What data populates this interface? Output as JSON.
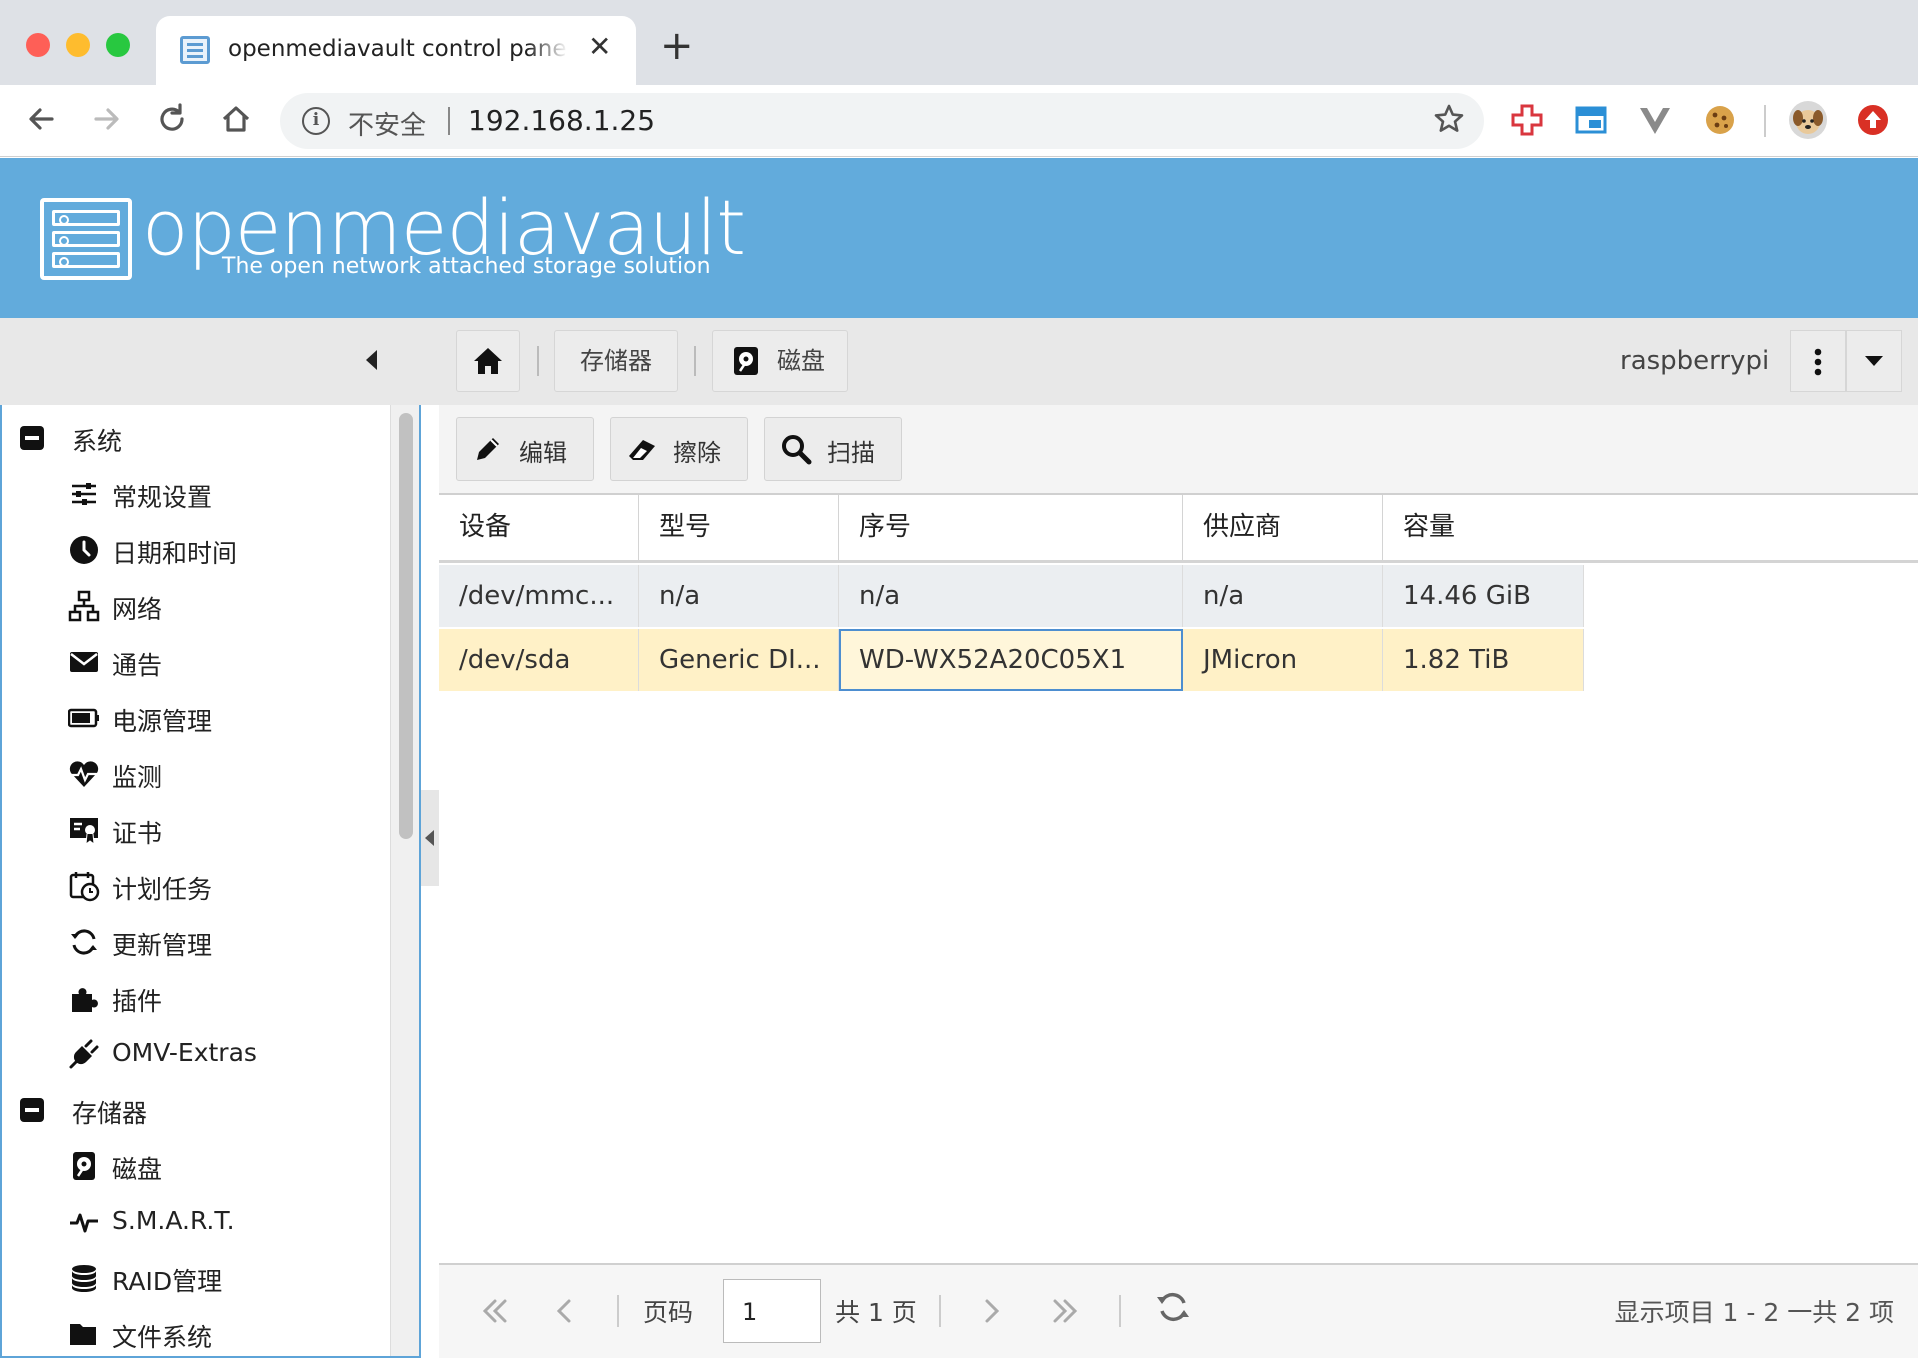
{
  "browser": {
    "tab_title": "openmediavault control panel - raspberrypi",
    "tab_close": "✕",
    "new_tab": "+",
    "security_label": "不安全",
    "url": "192.168.1.25"
  },
  "app": {
    "name": "openmediavault",
    "tagline": "The open network attached storage solution",
    "hostname": "raspberrypi"
  },
  "breadcrumb": [
    {
      "label": "存储器"
    },
    {
      "label": "磁盘"
    }
  ],
  "sidebar": {
    "groups": [
      {
        "label": "系统",
        "items": [
          {
            "label": "常规设置",
            "icon": "sliders-icon"
          },
          {
            "label": "日期和时间",
            "icon": "clock-icon"
          },
          {
            "label": "网络",
            "icon": "network-icon"
          },
          {
            "label": "通告",
            "icon": "envelope-icon"
          },
          {
            "label": "电源管理",
            "icon": "battery-icon"
          },
          {
            "label": "监测",
            "icon": "heartbeat-icon"
          },
          {
            "label": "证书",
            "icon": "certificate-icon"
          },
          {
            "label": "计划任务",
            "icon": "calendar-clock-icon"
          },
          {
            "label": "更新管理",
            "icon": "refresh-icon"
          },
          {
            "label": "插件",
            "icon": "puzzle-icon"
          },
          {
            "label": "OMV-Extras",
            "icon": "plug-icon"
          }
        ]
      },
      {
        "label": "存储器",
        "items": [
          {
            "label": "磁盘",
            "icon": "hdd-icon"
          },
          {
            "label": "S.M.A.R.T.",
            "icon": "pulse-icon"
          },
          {
            "label": "RAID管理",
            "icon": "database-icon"
          },
          {
            "label": "文件系统",
            "icon": "folder-icon"
          }
        ]
      }
    ]
  },
  "toolbar": {
    "edit": "编辑",
    "wipe": "擦除",
    "scan": "扫描"
  },
  "grid": {
    "columns": [
      "设备",
      "型号",
      "序号",
      "供应商",
      "容量"
    ],
    "rows": [
      [
        "/dev/mmc...",
        "n/a",
        "n/a",
        "n/a",
        "14.46 GiB"
      ],
      [
        "/dev/sda",
        "Generic DI...",
        "WD-WX52A20C05X1",
        "JMicron",
        "1.82 TiB"
      ]
    ]
  },
  "pager": {
    "page_label": "页码",
    "page_value": "1",
    "total_pages": "共 1 页",
    "status": "显示项目 1 - 2 一共 2 项"
  },
  "colors": {
    "header_bg": "#62abdc",
    "selected_row": "#fff1c7",
    "focus_border": "#4d8ed0"
  }
}
